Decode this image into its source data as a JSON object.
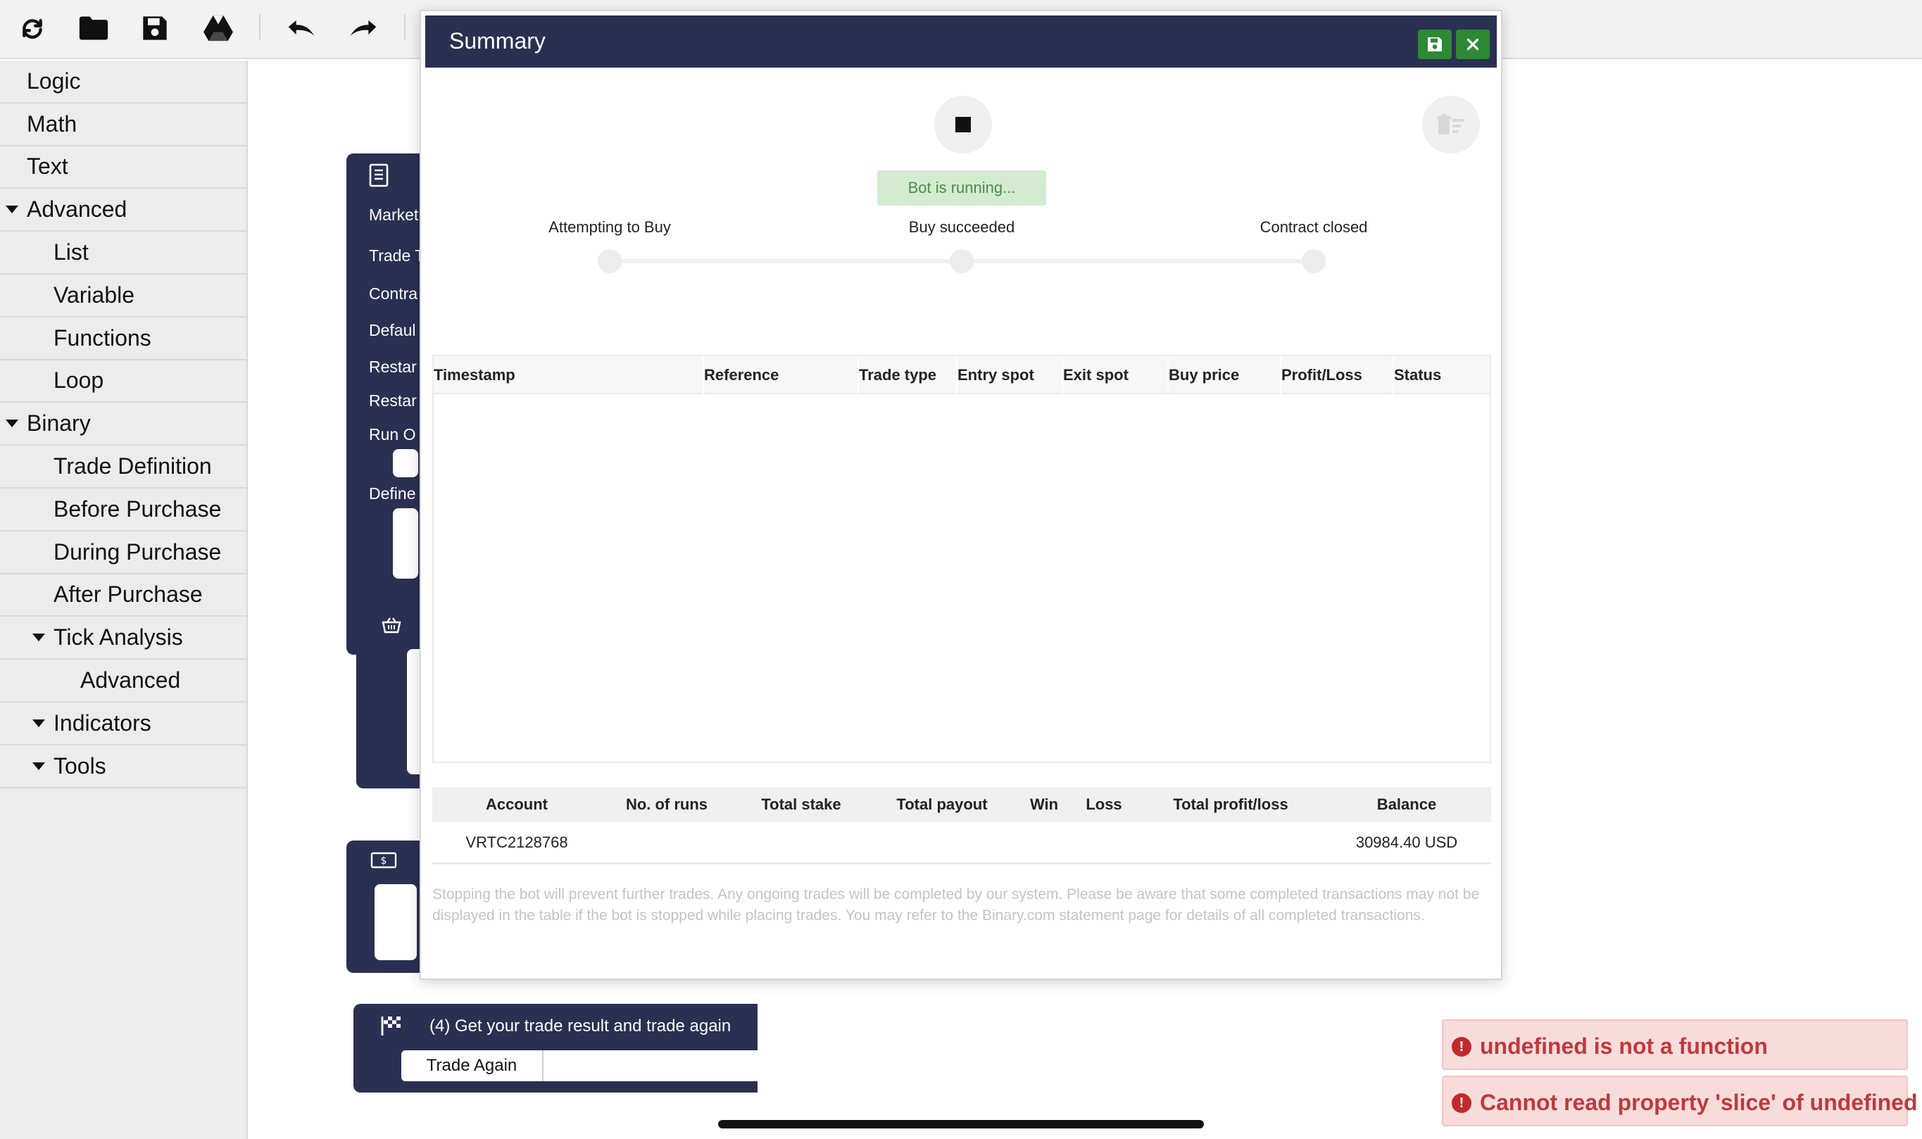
{
  "toolbar": {
    "buttons": [
      "reload-icon",
      "open-folder-icon",
      "save-icon",
      "google-drive-icon",
      "undo-icon",
      "redo-icon"
    ]
  },
  "sidebar": {
    "items": [
      {
        "label": "Logic",
        "level": 0,
        "expanded": false
      },
      {
        "label": "Math",
        "level": 0,
        "expanded": false
      },
      {
        "label": "Text",
        "level": 0,
        "expanded": false
      },
      {
        "label": "Advanced",
        "level": 0,
        "expanded": true
      },
      {
        "label": "List",
        "level": 1,
        "expanded": false
      },
      {
        "label": "Variable",
        "level": 1,
        "expanded": false
      },
      {
        "label": "Functions",
        "level": 1,
        "expanded": false
      },
      {
        "label": "Loop",
        "level": 1,
        "expanded": false
      },
      {
        "label": "Binary",
        "level": 0,
        "expanded": true
      },
      {
        "label": "Trade Definition",
        "level": 1,
        "expanded": false
      },
      {
        "label": "Before Purchase",
        "level": 1,
        "expanded": false
      },
      {
        "label": "During Purchase",
        "level": 1,
        "expanded": false
      },
      {
        "label": "After Purchase",
        "level": 1,
        "expanded": false
      },
      {
        "label": "Tick Analysis",
        "level": 1,
        "expanded": true
      },
      {
        "label": "Advanced",
        "level": 2,
        "expanded": false
      },
      {
        "label": "Indicators",
        "level": 1,
        "expanded": true
      },
      {
        "label": "Tools",
        "level": 1,
        "expanded": true
      }
    ]
  },
  "workspace": {
    "trade_block_labels": [
      "Market",
      "Trade T",
      "Contra",
      "Defaul",
      "Restar",
      "Restar",
      "Run O",
      "Define"
    ],
    "result_block": {
      "title": "(4) Get your trade result and trade again",
      "button": "Trade Again"
    }
  },
  "summary": {
    "title": "Summary",
    "status": "Bot is running...",
    "steps": [
      "Attempting to Buy",
      "Buy succeeded",
      "Contract closed"
    ],
    "trade_columns": [
      "Timestamp",
      "Reference",
      "Trade type",
      "Entry spot",
      "Exit spot",
      "Buy price",
      "Profit/Loss",
      "Status"
    ],
    "trade_rows": [],
    "stats_columns": [
      "Account",
      "No. of runs",
      "Total stake",
      "Total payout",
      "Win",
      "Loss",
      "Total profit/loss",
      "Balance"
    ],
    "stats_values": {
      "account": "VRTC2128768",
      "runs": "",
      "total_stake": "",
      "total_payout": "",
      "win": "",
      "loss": "",
      "total_profit_loss": "",
      "balance": "30984.40 USD"
    },
    "disclaimer": "Stopping the bot will prevent further trades. Any ongoing trades will be completed by our system. Please be aware that some completed transactions may not be displayed in the table if the bot is stopped while placing trades. You may refer to the Binary.com statement page for details of all completed transactions."
  },
  "errors": [
    "undefined is not a function",
    "Cannot read property 'slice' of undefined"
  ],
  "colors": {
    "header_navy": "#2a3052",
    "save_green": "#2e8836",
    "status_bg": "#d3ecd0",
    "status_text": "#4b8a4b",
    "error_bg": "#f8dcdc",
    "error_text": "#c0393b"
  }
}
